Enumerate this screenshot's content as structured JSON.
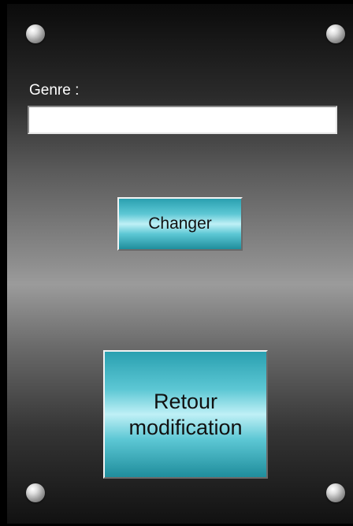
{
  "form": {
    "genre_label": "Genre :",
    "genre_value": "",
    "genre_placeholder": ""
  },
  "buttons": {
    "changer_label": "Changer",
    "retour_label": "Retour\nmodification"
  },
  "colors": {
    "button_accent": "#5cc7d4",
    "panel_dark": "#0b0b0b",
    "panel_light": "#9b9b9b"
  },
  "icons": [
    "screw-icon"
  ]
}
